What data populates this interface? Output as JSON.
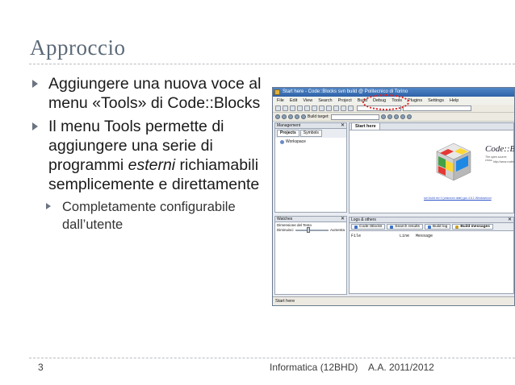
{
  "slide": {
    "title": "Approccio",
    "bullets": [
      {
        "text": "Aggiungere una nuova voce al menu «Tools» di Code::Blocks"
      },
      {
        "text_before": "Il menu Tools permette di aggiungere una serie di programmi ",
        "emph": "esterni",
        "text_after": " richiamabili semplicemente e direttamente"
      }
    ],
    "sub_bullets": [
      "Completamente configurabile dall’utente"
    ]
  },
  "footer": {
    "page": "3",
    "course": "Informatica (12BHD)",
    "year": "A.A. 2011/2012"
  },
  "codeblocks": {
    "window_title": "Start here - Code::Blocks svn build @ Politecnico di Torino",
    "menu": [
      "File",
      "Edit",
      "View",
      "Search",
      "Project",
      "Build",
      "Debug",
      "Tools",
      "Plugins",
      "Settings",
      "Help"
    ],
    "build_target_label": "Build target:",
    "management": {
      "title": "Management",
      "tabs": [
        "Projects",
        "Symbols"
      ],
      "workspace": "Workspace"
    },
    "watches": {
      "title": "Watches",
      "font_label": "Dimensione del Testo",
      "decrease": "Diminuisci",
      "increase": "Aumenta",
      "slider_level": 0.35
    },
    "editor_tab": "Start here",
    "start_page": {
      "brand": "Code::B",
      "subtitle": "The open source, cross-",
      "url": "http://www.codeb",
      "link": "svn build rev 0 (unknown date) gcc 4.6.1 Windows/uni"
    },
    "logs": {
      "title": "Logs & others",
      "tabs": [
        "Code::Blocks",
        "Search results",
        "Build log",
        "Build messages"
      ],
      "columns": [
        "File",
        "Line",
        "Message"
      ]
    },
    "status_bar": "Start here",
    "close_glyph": "✕",
    "colors": {
      "title_bar": "#2f62a8",
      "highlight_circle": "#e02020"
    }
  }
}
